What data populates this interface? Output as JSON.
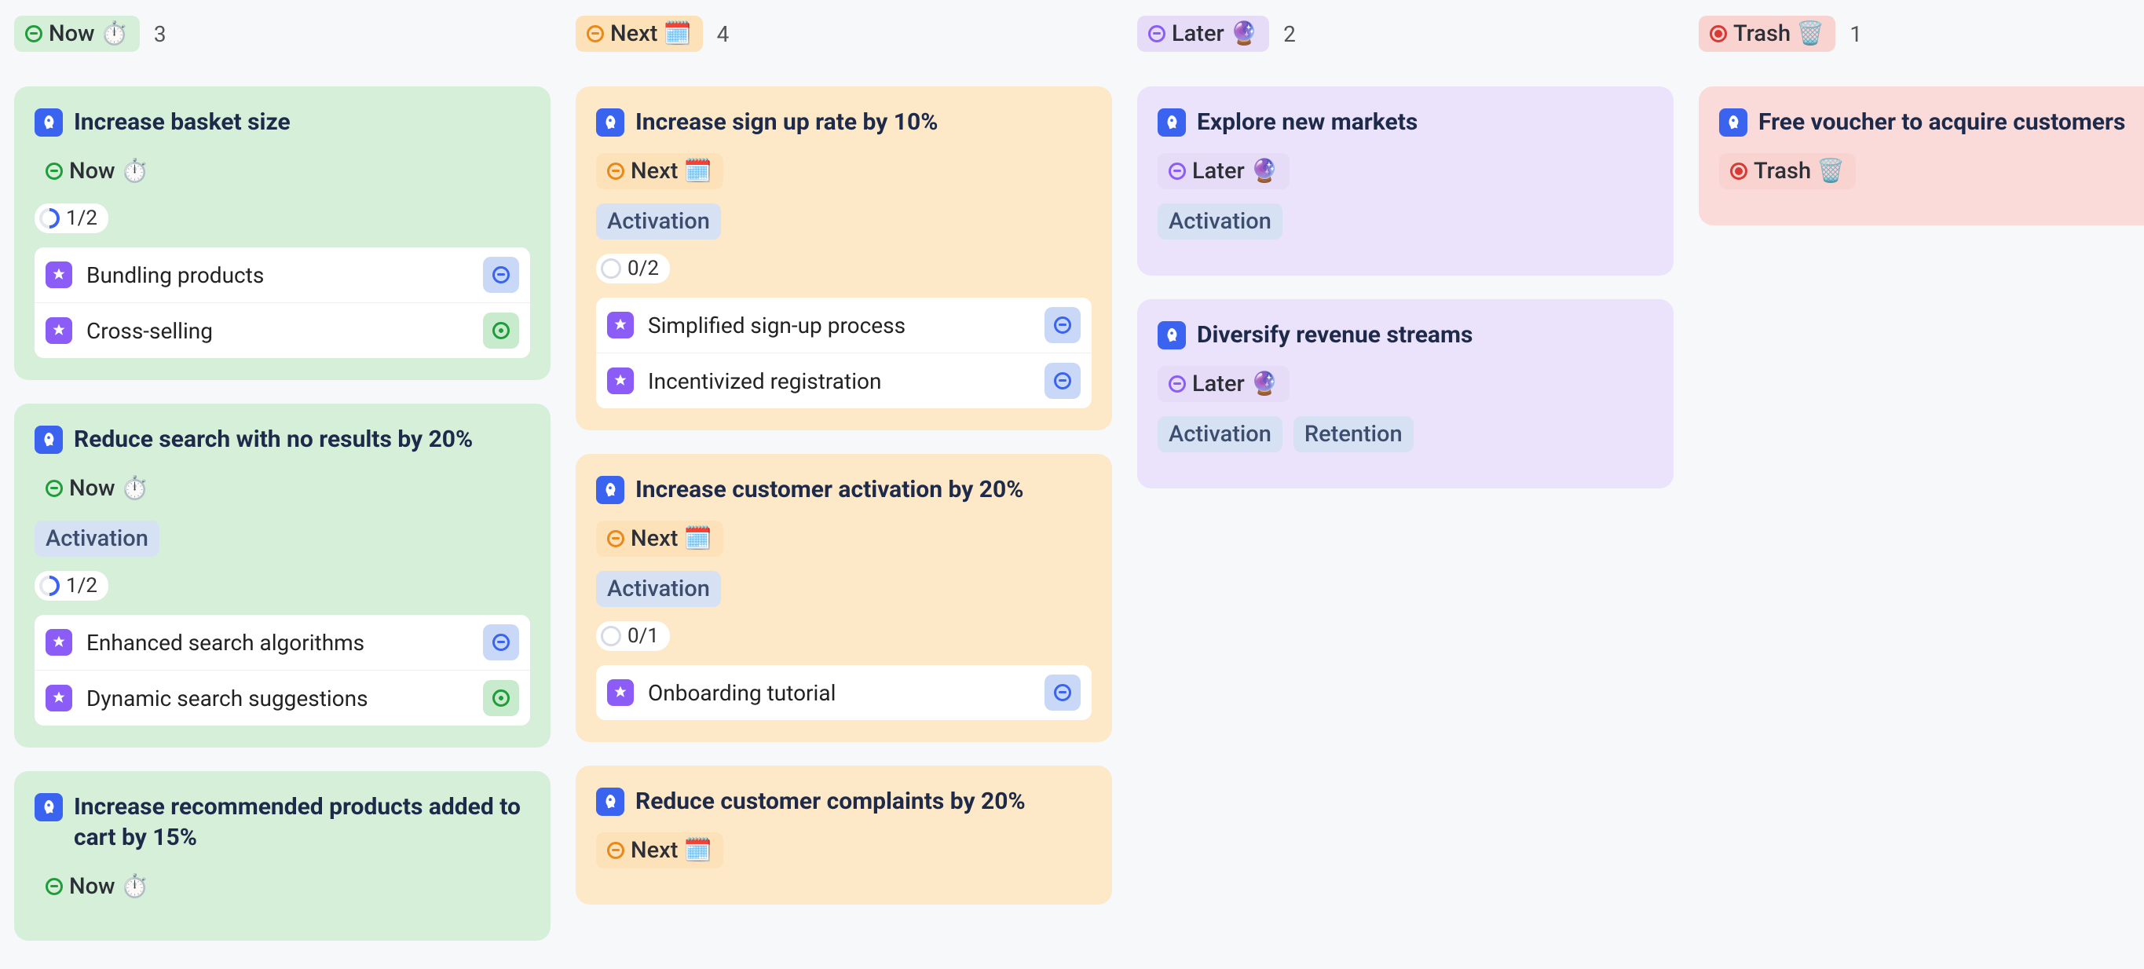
{
  "columns": [
    {
      "id": "now",
      "label": "Now ⏱️",
      "count": "3",
      "pillClass": "pill-now",
      "cardClass": "card-now",
      "iconClass": "green",
      "cards": [
        {
          "title": "Increase basket size",
          "status": {
            "label": "Now ⏱️",
            "icon": "green",
            "pill": "pill-now"
          },
          "tags": [],
          "progress": {
            "text": "1/2",
            "kind": "half"
          },
          "subtasks": [
            {
              "name": "Bundling products",
              "status": "blue"
            },
            {
              "name": "Cross-selling",
              "status": "green"
            }
          ]
        },
        {
          "title": "Reduce search with no results by 20%",
          "status": {
            "label": "Now ⏱️",
            "icon": "green",
            "pill": "pill-now"
          },
          "tags": [
            "Activation"
          ],
          "progress": {
            "text": "1/2",
            "kind": "half"
          },
          "subtasks": [
            {
              "name": "Enhanced search algorithms",
              "status": "blue"
            },
            {
              "name": "Dynamic search suggestions",
              "status": "green"
            }
          ]
        },
        {
          "title": "Increase recommended products added to cart by 15%",
          "status": {
            "label": "Now ⏱️",
            "icon": "green",
            "pill": "pill-now"
          },
          "tags": [],
          "progress": null,
          "subtasks": []
        }
      ]
    },
    {
      "id": "next",
      "label": "Next 🗓️",
      "count": "4",
      "pillClass": "pill-next",
      "cardClass": "card-next",
      "iconClass": "orange",
      "cards": [
        {
          "title": "Increase sign up rate by 10%",
          "status": {
            "label": "Next 🗓️",
            "icon": "orange",
            "pill": "pill-next"
          },
          "tags": [
            "Activation"
          ],
          "progress": {
            "text": "0/2",
            "kind": "empty"
          },
          "subtasks": [
            {
              "name": "Simplified sign-up process",
              "status": "blue"
            },
            {
              "name": "Incentivized registration",
              "status": "blue"
            }
          ]
        },
        {
          "title": "Increase customer activation by 20%",
          "status": {
            "label": "Next 🗓️",
            "icon": "orange",
            "pill": "pill-next"
          },
          "tags": [
            "Activation"
          ],
          "progress": {
            "text": "0/1",
            "kind": "empty"
          },
          "subtasks": [
            {
              "name": "Onboarding tutorial",
              "status": "blue"
            }
          ]
        },
        {
          "title": "Reduce customer complaints by 20%",
          "status": {
            "label": "Next 🗓️",
            "icon": "orange",
            "pill": "pill-next"
          },
          "tags": [],
          "progress": null,
          "subtasks": []
        }
      ]
    },
    {
      "id": "later",
      "label": "Later 🔮",
      "count": "2",
      "pillClass": "pill-later",
      "cardClass": "card-later",
      "iconClass": "purple",
      "cards": [
        {
          "title": "Explore new markets",
          "status": {
            "label": "Later 🔮",
            "icon": "purple",
            "pill": "pill-later"
          },
          "tags": [
            "Activation"
          ],
          "progress": null,
          "subtasks": []
        },
        {
          "title": "Diversify revenue streams",
          "status": {
            "label": "Later 🔮",
            "icon": "purple",
            "pill": "pill-later"
          },
          "tags": [
            "Activation",
            "Retention"
          ],
          "progress": null,
          "subtasks": []
        }
      ]
    },
    {
      "id": "trash",
      "label": "Trash 🗑️",
      "count": "1",
      "pillClass": "pill-trash",
      "cardClass": "card-trash",
      "iconClass": "red",
      "cards": [
        {
          "title": "Free voucher to acquire customers",
          "status": {
            "label": "Trash 🗑️",
            "icon": "red",
            "pill": "pill-trash"
          },
          "tags": [],
          "progress": null,
          "subtasks": []
        }
      ]
    }
  ]
}
